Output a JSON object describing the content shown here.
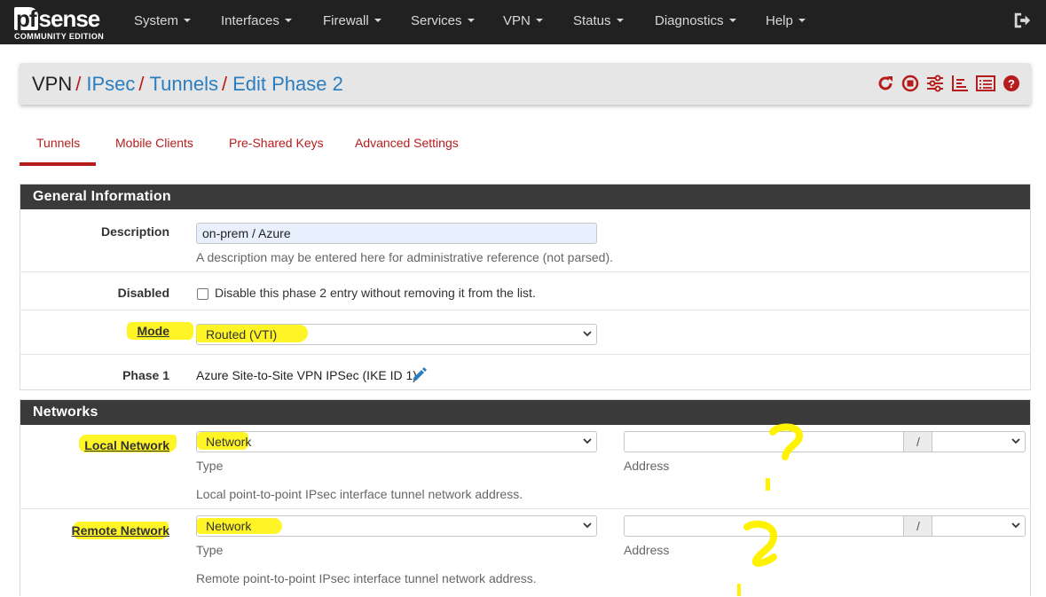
{
  "brand": {
    "name_pf": "pf",
    "name_sense": "sense",
    "edition": "COMMUNITY EDITION"
  },
  "nav": [
    "System",
    "Interfaces",
    "Firewall",
    "Services",
    "VPN",
    "Status",
    "Diagnostics",
    "Help"
  ],
  "breadcrumb": {
    "root": "VPN",
    "sep": "/",
    "l1": "IPsec",
    "l2": "Tunnels",
    "l3": "Edit Phase 2"
  },
  "icons": [
    "restart-icon",
    "stop-icon",
    "sliders-icon",
    "chart-icon",
    "log-icon",
    "help-icon"
  ],
  "tabs": [
    "Tunnels",
    "Mobile Clients",
    "Pre-Shared Keys",
    "Advanced Settings"
  ],
  "general": {
    "title": "General Information",
    "description_label": "Description",
    "description_value": "on-prem / Azure",
    "description_hint": "A description may be entered here for administrative reference (not parsed).",
    "disabled_label": "Disabled",
    "disabled_hint": "Disable this phase 2 entry without removing it from the list.",
    "mode_label": "Mode",
    "mode_value": "Routed (VTI)",
    "phase1_label": "Phase 1",
    "phase1_value": "Azure Site-to-Site VPN IPSec (IKE ID 1)"
  },
  "networks": {
    "title": "Networks",
    "local_label": "Local Network",
    "local_type": "Network",
    "local_hint": "Local point-to-point IPsec interface tunnel network address.",
    "remote_label": "Remote Network",
    "remote_type": "Network",
    "remote_hint": "Remote point-to-point IPsec interface tunnel network address.",
    "type_caption": "Type",
    "address_caption": "Address",
    "slash": "/"
  },
  "colors": {
    "accent": "#b71c1c",
    "link": "#2a7dbf",
    "navbar": "#212121",
    "highlight": "#fff200"
  }
}
